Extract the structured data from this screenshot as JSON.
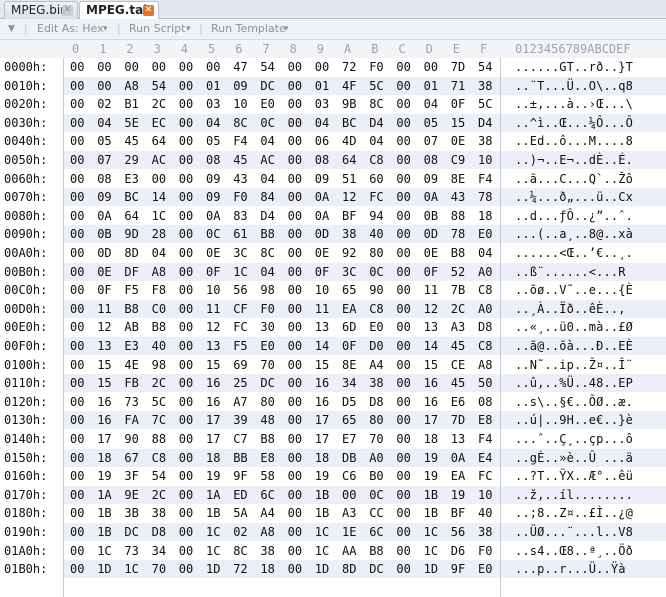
{
  "tabs": [
    {
      "label": "MPEG.bin",
      "active": false
    },
    {
      "label": "MPEG.tab",
      "active": true
    }
  ],
  "toolbar": {
    "collapse_icon": "chevron-down-icon",
    "edit_as": "Edit As: Hex",
    "run_script": "Run Script",
    "run_template": "Run Template"
  },
  "columns": [
    "0",
    "1",
    "2",
    "3",
    "4",
    "5",
    "6",
    "7",
    "8",
    "9",
    "A",
    "B",
    "C",
    "D",
    "E",
    "F"
  ],
  "ascii_header": "0123456789ABCDEF",
  "rows": [
    {
      "offset": "0000h:",
      "bytes": [
        "00",
        "00",
        "00",
        "00",
        "00",
        "00",
        "47",
        "54",
        "00",
        "00",
        "72",
        "F0",
        "00",
        "00",
        "7D",
        "54"
      ],
      "ascii": "......GT..rð..}T"
    },
    {
      "offset": "0010h:",
      "bytes": [
        "00",
        "00",
        "A8",
        "54",
        "00",
        "01",
        "09",
        "DC",
        "00",
        "01",
        "4F",
        "5C",
        "00",
        "01",
        "71",
        "38"
      ],
      "ascii": "..¨T...Ü..O\\..q8"
    },
    {
      "offset": "0020h:",
      "bytes": [
        "00",
        "02",
        "B1",
        "2C",
        "00",
        "03",
        "10",
        "E0",
        "00",
        "03",
        "9B",
        "8C",
        "00",
        "04",
        "0F",
        "5C"
      ],
      "ascii": "..±,...à..›Œ...\\"
    },
    {
      "offset": "0030h:",
      "bytes": [
        "00",
        "04",
        "5E",
        "EC",
        "00",
        "04",
        "8C",
        "0C",
        "00",
        "04",
        "BC",
        "D4",
        "00",
        "05",
        "15",
        "D4"
      ],
      "ascii": "..^ì..Œ...¼Ô...Ô"
    },
    {
      "offset": "0040h:",
      "bytes": [
        "00",
        "05",
        "45",
        "64",
        "00",
        "05",
        "F4",
        "04",
        "00",
        "06",
        "4D",
        "04",
        "00",
        "07",
        "0E",
        "38"
      ],
      "ascii": "..Ed..ô...M....8"
    },
    {
      "offset": "0050h:",
      "bytes": [
        "00",
        "07",
        "29",
        "AC",
        "00",
        "08",
        "45",
        "AC",
        "00",
        "08",
        "64",
        "C8",
        "00",
        "08",
        "C9",
        "10"
      ],
      "ascii": "..)¬..E¬..dÈ..É."
    },
    {
      "offset": "0060h:",
      "bytes": [
        "00",
        "08",
        "E3",
        "00",
        "00",
        "09",
        "43",
        "04",
        "00",
        "09",
        "51",
        "60",
        "00",
        "09",
        "8E",
        "F4"
      ],
      "ascii": "..ã...C...Q`..Žô"
    },
    {
      "offset": "0070h:",
      "bytes": [
        "00",
        "09",
        "BC",
        "14",
        "00",
        "09",
        "F0",
        "84",
        "00",
        "0A",
        "12",
        "FC",
        "00",
        "0A",
        "43",
        "78"
      ],
      "ascii": "..¼...ð„...ü..Cx"
    },
    {
      "offset": "0080h:",
      "bytes": [
        "00",
        "0A",
        "64",
        "1C",
        "00",
        "0A",
        "83",
        "D4",
        "00",
        "0A",
        "BF",
        "94",
        "00",
        "0B",
        "88",
        "18"
      ],
      "ascii": "..d...ƒÔ..¿”..ˆ."
    },
    {
      "offset": "0090h:",
      "bytes": [
        "00",
        "0B",
        "9D",
        "28",
        "00",
        "0C",
        "61",
        "B8",
        "00",
        "0D",
        "38",
        "40",
        "00",
        "0D",
        "78",
        "E0"
      ],
      "ascii": "...(..a¸..8@..xà"
    },
    {
      "offset": "00A0h:",
      "bytes": [
        "00",
        "0D",
        "8D",
        "04",
        "00",
        "0E",
        "3C",
        "8C",
        "00",
        "0E",
        "92",
        "80",
        "00",
        "0E",
        "B8",
        "04"
      ],
      "ascii": "......<Œ..’€..¸."
    },
    {
      "offset": "00B0h:",
      "bytes": [
        "00",
        "0E",
        "DF",
        "A8",
        "00",
        "0F",
        "1C",
        "04",
        "00",
        "0F",
        "3C",
        "0C",
        "00",
        "0F",
        "52",
        "A0"
      ],
      "ascii": "..ß¨......<...R "
    },
    {
      "offset": "00C0h:",
      "bytes": [
        "00",
        "0F",
        "F5",
        "F8",
        "00",
        "10",
        "56",
        "98",
        "00",
        "10",
        "65",
        "90",
        "00",
        "11",
        "7B",
        "C8"
      ],
      "ascii": "..õø..V˜..e...{È"
    },
    {
      "offset": "00D0h:",
      "bytes": [
        "00",
        "11",
        "B8",
        "C0",
        "00",
        "11",
        "CF",
        "F0",
        "00",
        "11",
        "EA",
        "C8",
        "00",
        "12",
        "2C",
        "A0"
      ],
      "ascii": "..¸À..Ïð..êÈ..,"
    },
    {
      "offset": "00E0h:",
      "bytes": [
        "00",
        "12",
        "AB",
        "B8",
        "00",
        "12",
        "FC",
        "30",
        "00",
        "13",
        "6D",
        "E0",
        "00",
        "13",
        "A3",
        "D8"
      ],
      "ascii": "..«¸..ü0..mà..£Ø"
    },
    {
      "offset": "00F0h:",
      "bytes": [
        "00",
        "13",
        "E3",
        "40",
        "00",
        "13",
        "F5",
        "E0",
        "00",
        "14",
        "0F",
        "D0",
        "00",
        "14",
        "45",
        "C8"
      ],
      "ascii": "..ã@..õà...Ð..EÈ"
    },
    {
      "offset": "0100h:",
      "bytes": [
        "00",
        "15",
        "4E",
        "98",
        "00",
        "15",
        "69",
        "70",
        "00",
        "15",
        "8E",
        "A4",
        "00",
        "15",
        "CE",
        "A8"
      ],
      "ascii": "..N˜..ip..Ž¤..Î¨"
    },
    {
      "offset": "0110h:",
      "bytes": [
        "00",
        "15",
        "FB",
        "2C",
        "00",
        "16",
        "25",
        "DC",
        "00",
        "16",
        "34",
        "38",
        "00",
        "16",
        "45",
        "50"
      ],
      "ascii": "..û,..%Ü..48..EP"
    },
    {
      "offset": "0120h:",
      "bytes": [
        "00",
        "16",
        "73",
        "5C",
        "00",
        "16",
        "A7",
        "80",
        "00",
        "16",
        "D5",
        "D8",
        "00",
        "16",
        "E6",
        "08"
      ],
      "ascii": "..s\\..§€..ÕØ..æ."
    },
    {
      "offset": "0130h:",
      "bytes": [
        "00",
        "16",
        "FA",
        "7C",
        "00",
        "17",
        "39",
        "48",
        "00",
        "17",
        "65",
        "80",
        "00",
        "17",
        "7D",
        "E8"
      ],
      "ascii": "..ú|..9H..e€..}è"
    },
    {
      "offset": "0140h:",
      "bytes": [
        "00",
        "17",
        "90",
        "88",
        "00",
        "17",
        "C7",
        "B8",
        "00",
        "17",
        "E7",
        "70",
        "00",
        "18",
        "13",
        "F4"
      ],
      "ascii": "...ˆ..Ç¸..çp...ô"
    },
    {
      "offset": "0150h:",
      "bytes": [
        "00",
        "18",
        "67",
        "C8",
        "00",
        "18",
        "BB",
        "E8",
        "00",
        "18",
        "DB",
        "A0",
        "00",
        "19",
        "0A",
        "E4"
      ],
      "ascii": "..gÈ..»è..Û ...ä"
    },
    {
      "offset": "0160h:",
      "bytes": [
        "00",
        "19",
        "3F",
        "54",
        "00",
        "19",
        "9F",
        "58",
        "00",
        "19",
        "C6",
        "B0",
        "00",
        "19",
        "EA",
        "FC"
      ],
      "ascii": "..?T..ŸX..Æ°..êü"
    },
    {
      "offset": "0170h:",
      "bytes": [
        "00",
        "1A",
        "9E",
        "2C",
        "00",
        "1A",
        "ED",
        "6C",
        "00",
        "1B",
        "00",
        "0C",
        "00",
        "1B",
        "19",
        "10"
      ],
      "ascii": "..ž,..íl........"
    },
    {
      "offset": "0180h:",
      "bytes": [
        "00",
        "1B",
        "3B",
        "38",
        "00",
        "1B",
        "5A",
        "A4",
        "00",
        "1B",
        "A3",
        "CC",
        "00",
        "1B",
        "BF",
        "40"
      ],
      "ascii": "..;8..Z¤..£Ì..¿@"
    },
    {
      "offset": "0190h:",
      "bytes": [
        "00",
        "1B",
        "DC",
        "D8",
        "00",
        "1C",
        "02",
        "A8",
        "00",
        "1C",
        "1E",
        "6C",
        "00",
        "1C",
        "56",
        "38"
      ],
      "ascii": "..ÜØ...¨...l..V8"
    },
    {
      "offset": "01A0h:",
      "bytes": [
        "00",
        "1C",
        "73",
        "34",
        "00",
        "1C",
        "8C",
        "38",
        "00",
        "1C",
        "AA",
        "B8",
        "00",
        "1C",
        "D6",
        "F0"
      ],
      "ascii": "..s4..Œ8..ª¸..Öð"
    },
    {
      "offset": "01B0h:",
      "bytes": [
        "00",
        "1D",
        "1C",
        "70",
        "00",
        "1D",
        "72",
        "18",
        "00",
        "1D",
        "8D",
        "DC",
        "00",
        "1D",
        "9F",
        "E0"
      ],
      "ascii": "...p..r...Ü..Ÿà"
    }
  ]
}
